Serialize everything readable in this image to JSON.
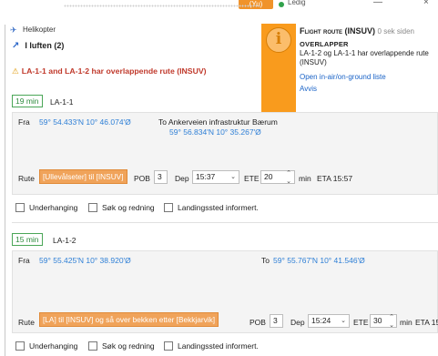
{
  "topbar": {
    "status": "(Yu)",
    "state": "Ledig",
    "minimize": "—",
    "close": "×"
  },
  "window": {
    "title": "Helikopter"
  },
  "in_air": {
    "label": "I luften (2)"
  },
  "warning": {
    "text": "LA-1-1 and LA-1-2 har overlappende rute (INSUV)"
  },
  "notification": {
    "title": "Flight route (INSUV)",
    "age": "0 sek siden",
    "tag": "OVERLAPPER",
    "body": "LA-1-2 og LA-1-1 har overlappende rute (INSUV)",
    "link_open": "Open in-air/on-ground liste",
    "link_dismiss": "Avvis"
  },
  "flights": [
    {
      "minutes": "19 min",
      "callsign": "LA-1-1",
      "from_label": "Fra",
      "from_coord": "59° 54.433'N 10° 46.074'Ø",
      "to_label": "To Ankerveien infrastruktur Bærum",
      "to_coord": "59° 56.834'N 10° 35.267'Ø",
      "route_label": "Rute",
      "route": "[Ullevålseter] til [INSUV]",
      "pob_label": "POB",
      "pob": "3",
      "dep_label": "Dep",
      "dep": "15:37",
      "ete_label": "ETE",
      "ete": "20",
      "ete_unit": "min",
      "eta": "ETA 15:57",
      "checkboxes": [
        "Underhanging",
        "Søk og redning",
        "Landingssted informert."
      ]
    },
    {
      "minutes": "15 min",
      "callsign": "LA-1-2",
      "from_label": "Fra",
      "from_coord": "59° 55.425'N 10° 38.920'Ø",
      "to_label": "To",
      "to_coord": "59° 55.767'N 10° 41.546'Ø",
      "route_label": "Rute",
      "route": "[LA] til [INSUV] og så over bekken etter [Bekkjarvik]",
      "pob_label": "POB",
      "pob": "3",
      "dep_label": "Dep",
      "dep": "15:24",
      "ete_label": "ETE",
      "ete": "30",
      "ete_unit": "min",
      "eta": "ETA 15:5",
      "checkboxes": [
        "Underhanging",
        "Søk og redning",
        "Landingssted informert."
      ]
    }
  ],
  "colors": {
    "accent": "#f99b1d",
    "warning": "#c0392b",
    "link": "#1a63c7",
    "badge": "#4aa657",
    "route": "#f0a35a"
  }
}
